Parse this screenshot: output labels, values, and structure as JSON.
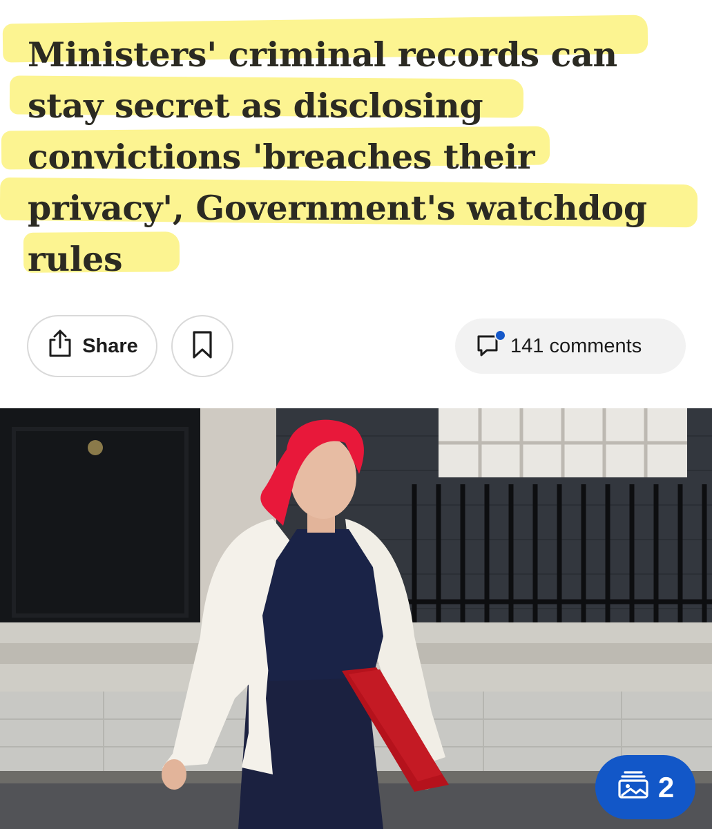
{
  "article": {
    "headline_lines": [
      "Ministers' criminal records can",
      "stay secret as disclosing",
      "convictions 'breaches their",
      "privacy', Government's watchdog",
      "rules"
    ],
    "highlight_color": "#fbf27e"
  },
  "actions": {
    "share_label": "Share",
    "comments_label": "141 comments",
    "icons": {
      "share": "share-icon",
      "bookmark": "bookmark-icon",
      "comments": "comment-bubble-icon"
    },
    "notification_dot_color": "#1558c9"
  },
  "photo": {
    "gallery_count": "2",
    "gallery_icon": "photo-stack-icon",
    "badge_color": "#1257c8"
  }
}
